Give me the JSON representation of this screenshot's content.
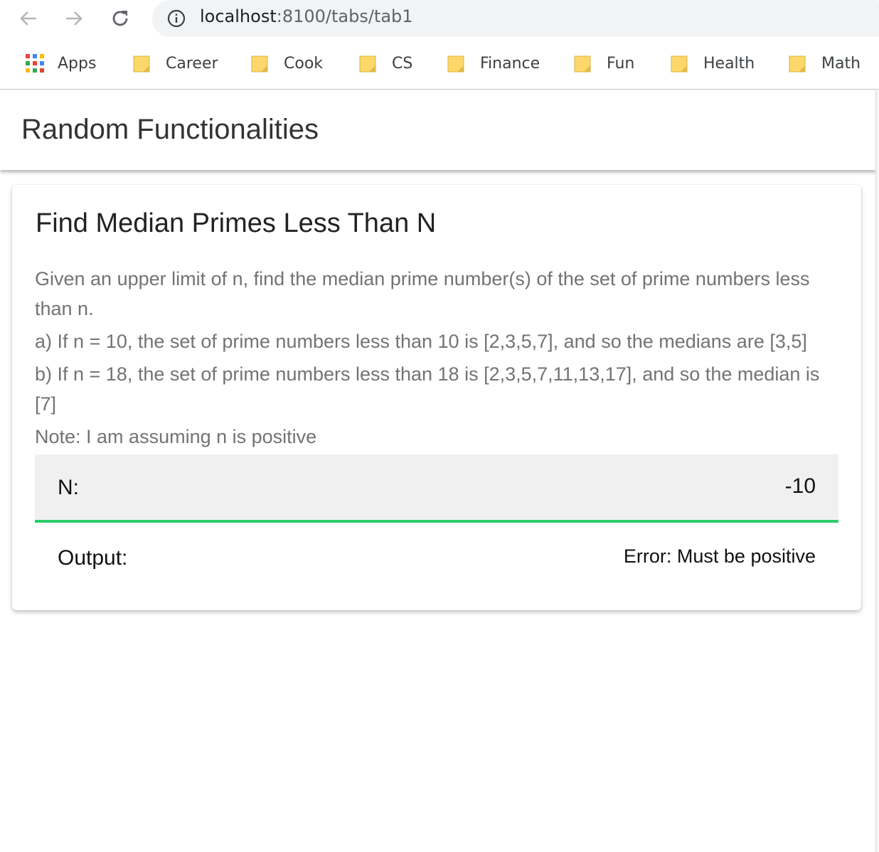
{
  "browser": {
    "url_host": "localhost",
    "url_path": ":8100/tabs/tab1",
    "bookmarks": [
      {
        "label": "Apps",
        "icon": "apps-grid-icon"
      },
      {
        "label": "Career",
        "icon": "folder-icon"
      },
      {
        "label": "Cook",
        "icon": "folder-icon"
      },
      {
        "label": "CS",
        "icon": "folder-icon"
      },
      {
        "label": "Finance",
        "icon": "folder-icon"
      },
      {
        "label": "Fun",
        "icon": "folder-icon"
      },
      {
        "label": "Health",
        "icon": "folder-icon"
      },
      {
        "label": "Math",
        "icon": "folder-icon"
      }
    ]
  },
  "header": {
    "title": "Random Functionalities"
  },
  "card": {
    "title": "Find Median Primes Less Than N",
    "description": [
      "Given an upper limit of n, find the median prime number(s) of the set of prime numbers less than n.",
      "a) If n = 10, the set of prime numbers less than 10 is [2,3,5,7], and so the medians are [3,5]",
      "b) If n = 18, the set of prime numbers less than 18 is [2,3,5,7,11,13,17], and so the median is [7]",
      "Note: I am assuming n is positive"
    ],
    "input": {
      "label": "N:",
      "value": "-10"
    },
    "output": {
      "label": "Output:",
      "value": "Error: Must be positive"
    }
  },
  "colors": {
    "input_underline": "#2dce6a",
    "folder": "#fcd86b",
    "description_text": "#737373"
  }
}
